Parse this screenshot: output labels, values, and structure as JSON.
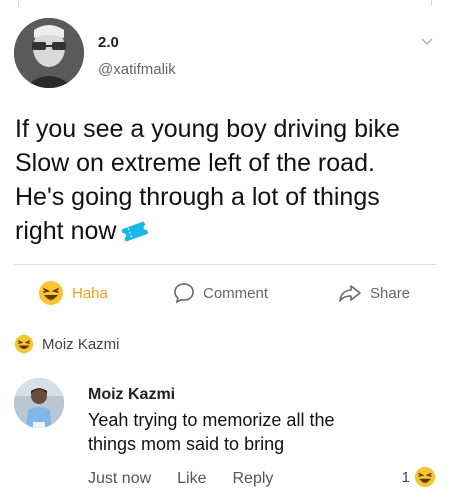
{
  "post": {
    "author_name": "2.0",
    "author_handle": "@xatifmalik",
    "lines": [
      "If you see a young boy driving bike",
      "Slow on extreme left of the road.",
      "He's going through a lot of things",
      "right now"
    ],
    "emoji": "ticket-emoji"
  },
  "actions": {
    "haha_label": "Haha",
    "comment_label": "Comment",
    "share_label": "Share"
  },
  "reactors": {
    "name": "Moiz Kazmi"
  },
  "comment": {
    "author": "Moiz Kazmi",
    "text_lines": [
      "Yeah trying to memorize all the",
      "things mom said to bring"
    ],
    "time": "Just now",
    "like_label": "Like",
    "reply_label": "Reply",
    "reaction_count": "1"
  },
  "colors": {
    "haha_accent": "#f0a21f",
    "emoji_yellow": "#f7c533",
    "ticket_blue": "#1ab6e8"
  }
}
